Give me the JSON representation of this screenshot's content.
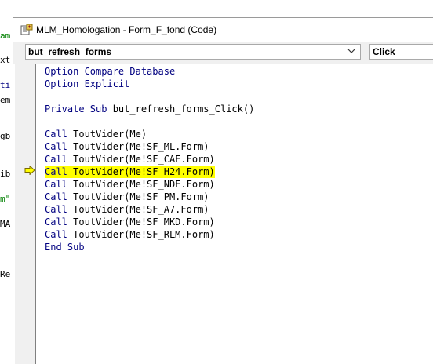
{
  "background_editor": {
    "fragments": [
      {
        "text": "am",
        "color": "#008000"
      },
      {
        "text": "xt",
        "color": "#000000"
      },
      {
        "text": "ti",
        "color": "#000080"
      },
      {
        "text": "em",
        "color": "#000000"
      },
      {
        "text": "gb",
        "color": "#000000"
      },
      {
        "text": "ib",
        "color": "#000000"
      },
      {
        "text": "m\"",
        "color": "#008000"
      },
      {
        "text": "MA",
        "color": "#000000"
      },
      {
        "text": "Re",
        "color": "#000000"
      }
    ]
  },
  "window": {
    "title": "MLM_Homologation - Form_F_fond (Code)",
    "title_icon": "vba-module-icon"
  },
  "toolbar": {
    "object_combo": "but_refresh_forms",
    "procedure_combo": "Click"
  },
  "code": {
    "keyword_color": "#000080",
    "highlight_color": "#ffff00",
    "current_line_index": 8,
    "lines": [
      "Option Compare Database",
      "Option Explicit",
      "",
      "Private Sub but_refresh_forms_Click()",
      "",
      "Call ToutVider(Me)",
      "Call ToutVider(Me!SF_ML.Form)",
      "Call ToutVider(Me!SF_CAF.Form)",
      "Call ToutVider(Me!SF_H24.Form)",
      "Call ToutVider(Me!SF_NDF.Form)",
      "Call ToutVider(Me!SF_PM.Form)",
      "Call ToutVider(Me!SF_A7.Form)",
      "Call ToutVider(Me!SF_MKD.Form)",
      "Call ToutVider(Me!SF_RLM.Form)",
      "End Sub"
    ]
  }
}
